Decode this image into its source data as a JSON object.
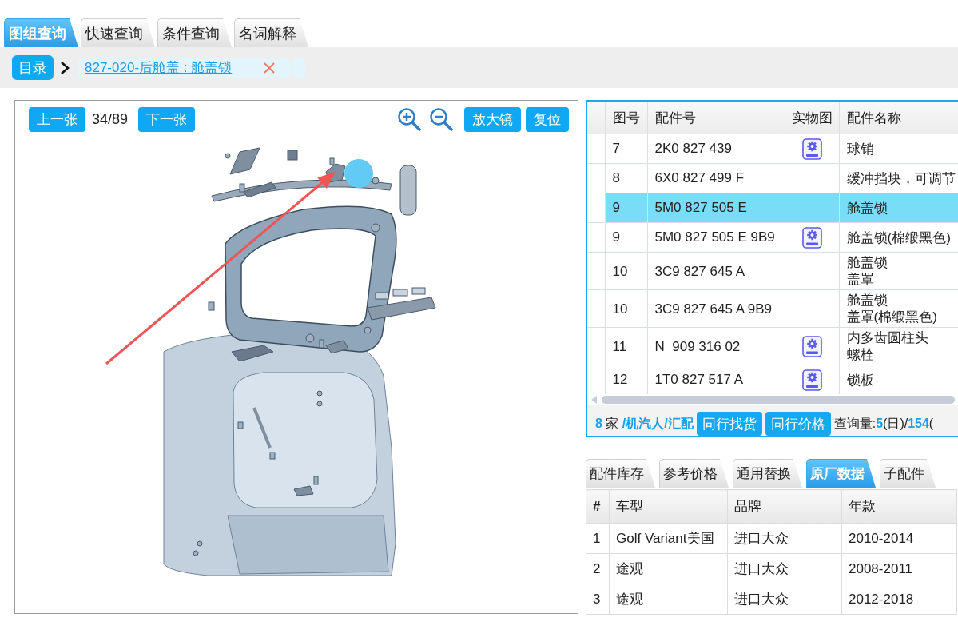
{
  "top_tabs": [
    {
      "label": "图组查询",
      "selected": true
    },
    {
      "label": "快速查询",
      "selected": false
    },
    {
      "label": "条件查询",
      "selected": false
    },
    {
      "label": "名词解释",
      "selected": false
    }
  ],
  "breadcrumb": {
    "home": "目录",
    "path": "827-020-后舱盖 : 舱盖锁"
  },
  "diagram_toolbar": {
    "prev": "上一张",
    "page": "34/89",
    "next": "下一张",
    "buttons": [
      "放大镜",
      "复位"
    ]
  },
  "parts_table": {
    "columns": [
      "图号",
      "配件号",
      "实物图",
      "配件名称"
    ],
    "rows": [
      {
        "no": "7",
        "part_no": "2K0 827 439",
        "photo": true,
        "name": [
          "球销"
        ],
        "selected": false
      },
      {
        "no": "8",
        "part_no": "6X0 827 499 F",
        "photo": false,
        "name": [
          "缓冲挡块，可调节"
        ],
        "selected": false
      },
      {
        "no": "9",
        "part_no": "5M0 827 505 E",
        "photo": false,
        "name": [
          "舱盖锁"
        ],
        "selected": true
      },
      {
        "no": "9",
        "part_no": "5M0 827 505 E 9B9",
        "photo": true,
        "name": [
          "舱盖锁(棉缎黑色)"
        ],
        "selected": false
      },
      {
        "no": "10",
        "part_no": "3C9 827 645 A",
        "photo": false,
        "name": [
          "舱盖锁",
          "盖罩"
        ],
        "selected": false
      },
      {
        "no": "10",
        "part_no": "3C9 827 645 A 9B9",
        "photo": false,
        "name": [
          "舱盖锁",
          "盖罩(棉缎黑色)"
        ],
        "selected": false
      },
      {
        "no": "11",
        "part_no": "N  909 316 02",
        "photo": true,
        "name": [
          "内多齿圆柱头",
          "螺栓"
        ],
        "selected": false
      },
      {
        "no": "12",
        "part_no": "1T0 827 517 A",
        "photo": true,
        "name": [
          "锁板"
        ],
        "selected": false
      }
    ]
  },
  "parts_footer": {
    "suppliers": "**8** 家 **/机汽人/汇配**",
    "buttons": [
      "同行找货",
      "同行价格"
    ],
    "queries": "查询量:**5**(日)/**154**("
  },
  "detail_tabs": [
    {
      "label": "配件库存",
      "selected": false
    },
    {
      "label": "参考价格",
      "selected": false
    },
    {
      "label": "通用替换",
      "selected": false
    },
    {
      "label": "原厂数据",
      "selected": true
    },
    {
      "label": "子配件",
      "selected": false
    }
  ],
  "oem_table": {
    "columns": [
      "#",
      "车型",
      "品牌",
      "年款"
    ],
    "rows": [
      [
        "1",
        "Golf Variant美国",
        "进口大众",
        "2010-2014"
      ],
      [
        "2",
        "途观",
        "进口大众",
        "2008-2011"
      ],
      [
        "3",
        "途观",
        "进口大众",
        "2012-2018"
      ]
    ]
  }
}
